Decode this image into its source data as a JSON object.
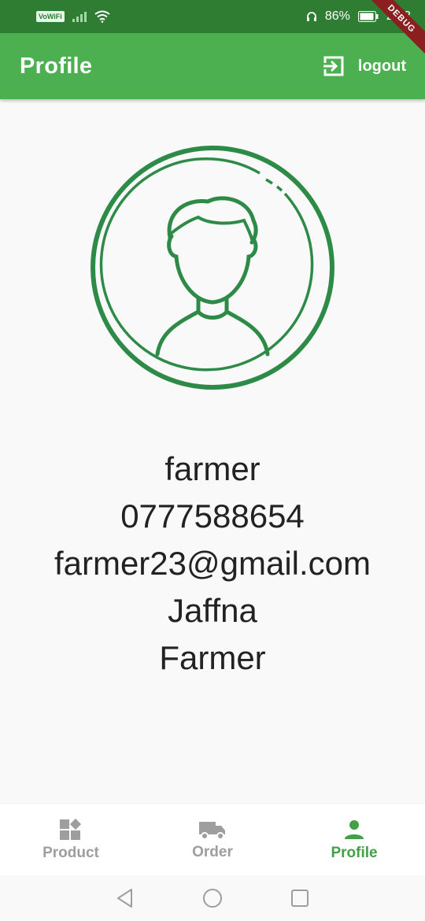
{
  "status_bar": {
    "network_badge": "VoWiFi",
    "battery_percent": "86%",
    "time": "22:3",
    "debug_label": "DEBUG"
  },
  "app_bar": {
    "title": "Profile",
    "logout_label": "logout"
  },
  "profile": {
    "name": "farmer",
    "phone": "0777588654",
    "email": "farmer23@gmail.com",
    "city": "Jaffna",
    "role": "Farmer"
  },
  "bottom_nav": {
    "items": [
      {
        "label": "Product",
        "icon": "dashboard-icon",
        "active": false
      },
      {
        "label": "Order",
        "icon": "truck-icon",
        "active": false
      },
      {
        "label": "Profile",
        "icon": "person-icon",
        "active": true
      }
    ]
  },
  "colors": {
    "status_bar": "#2e7d32",
    "app_bar": "#4caf50",
    "accent": "#43a047",
    "avatar_stroke": "#2e8b47",
    "inactive": "#9e9e9e"
  }
}
